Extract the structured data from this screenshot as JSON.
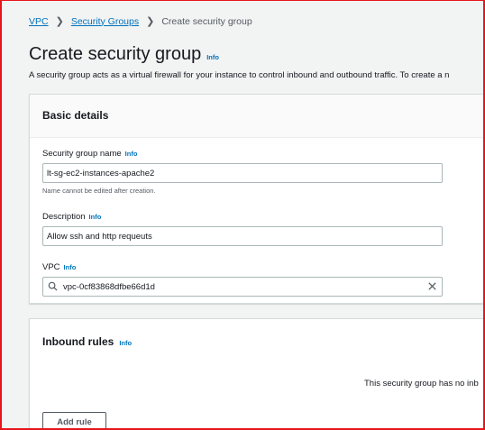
{
  "breadcrumb": {
    "items": [
      "VPC",
      "Security Groups"
    ],
    "current": "Create security group"
  },
  "page": {
    "title": "Create security group",
    "info": "Info",
    "description": "A security group acts as a virtual firewall for your instance to control inbound and outbound traffic. To create a n"
  },
  "basic_details": {
    "heading": "Basic details",
    "name_label": "Security group name",
    "name_info": "Info",
    "name_value": "lt-sg-ec2-instances-apache2",
    "name_hint": "Name cannot be edited after creation.",
    "description_label": "Description",
    "description_info": "Info",
    "description_value": "Allow ssh and http requeuts",
    "vpc_label": "VPC",
    "vpc_info": "Info",
    "vpc_value": "vpc-0cf83868dfbe66d1d"
  },
  "inbound": {
    "heading": "Inbound rules",
    "info": "Info",
    "empty_message": "This security group has no inb",
    "add_rule_label": "Add rule"
  },
  "colors": {
    "link": "#0073bb",
    "frame_border": "#e8141c",
    "background": "#f2f3f3"
  },
  "icons": {
    "breadcrumb_separator": "chevron-right-icon",
    "vpc_search": "search-icon",
    "vpc_clear": "close-icon"
  }
}
